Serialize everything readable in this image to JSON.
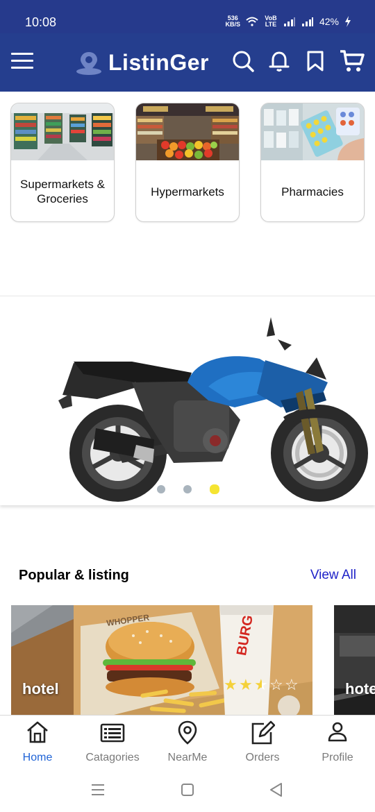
{
  "status_bar": {
    "time": "10:08",
    "net_speed": "536",
    "net_unit": "KB/S",
    "volte": "VoB LTE",
    "battery": "42%"
  },
  "app": {
    "name": "ListinGer"
  },
  "categories": [
    {
      "label": "Supermarkets & Groceries"
    },
    {
      "label": "Hypermarkets"
    },
    {
      "label": "Pharmacies"
    }
  ],
  "carousel": {
    "slide_count": 3,
    "active_index": 2
  },
  "popular": {
    "title": "Popular & listing",
    "view_all": "View All",
    "items": [
      {
        "name": "hotel",
        "rating": 2.5,
        "max_rating": 5,
        "brand_text": "BURGER KING",
        "sign_text": "WHOPPER"
      },
      {
        "name": "hotel"
      }
    ]
  },
  "bottom_nav": [
    {
      "label": "Home",
      "icon": "home-icon",
      "active": true
    },
    {
      "label": "Catagories",
      "icon": "list-icon",
      "active": false
    },
    {
      "label": "NearMe",
      "icon": "location-pin-icon",
      "active": false
    },
    {
      "label": "Orders",
      "icon": "edit-icon",
      "active": false
    },
    {
      "label": "Profile",
      "icon": "person-icon",
      "active": false
    }
  ],
  "colors": {
    "primary": "#253e8e",
    "status_bar": "#263a8c",
    "accent_link": "#1e22c8",
    "nav_active": "#1f63d6",
    "dot_active": "#f5e432",
    "star": "#f4d13a"
  }
}
